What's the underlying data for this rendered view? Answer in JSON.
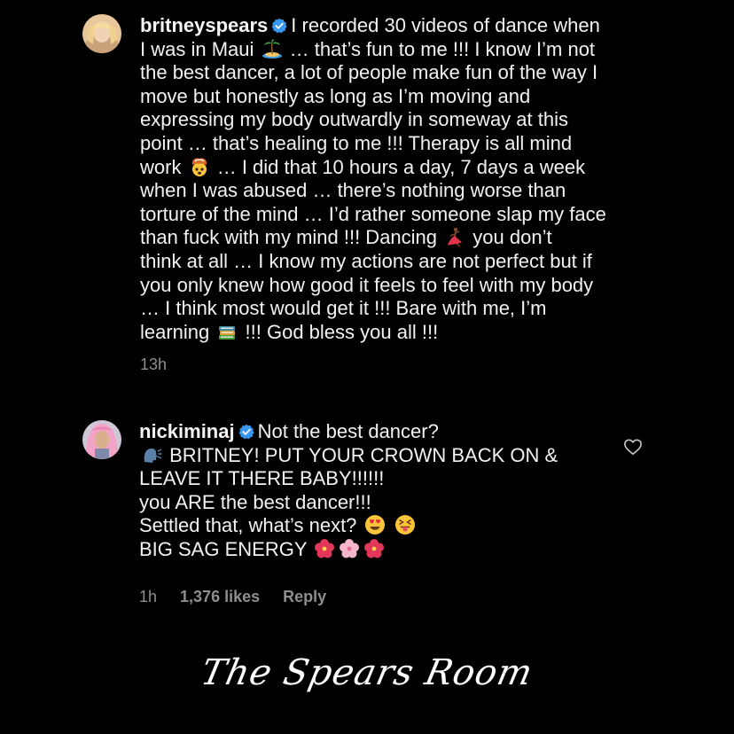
{
  "comments": [
    {
      "username": "britneyspears",
      "lines": [
        "I recorded 30 videos of dance when",
        "I was in Maui",
        "… that’s fun to me !!! I know I’m not",
        "the best dancer, a lot of people make fun of the way I",
        "move but honestly as long as I’m moving and",
        "expressing my body outwardly in someway at this",
        "point … that’s healing to me !!! Therapy is all mind",
        "work",
        "… I did that 10 hours a day, 7 days a week",
        "when I was abused … there’s nothing worse than",
        "torture of the mind … I’d rather someone slap my face",
        "than fuck with my mind !!! Dancing",
        "you don’t",
        "think at all … I know my actions are not perfect but if",
        "you only knew how good it feels to feel with my body",
        "… I think most would get it !!! Bare with me, I’m",
        "learning",
        "!!! God bless you all !!!"
      ],
      "time": "13h"
    },
    {
      "username": "nickiminaj",
      "lines": [
        "Not the best dancer?",
        "BRITNEY! PUT YOUR CROWN BACK ON &",
        "LEAVE IT THERE BABY!!!!!!",
        "you ARE the best dancer!!!",
        "Settled that, what’s next?",
        "BIG SAG ENERGY"
      ],
      "time": "1h",
      "likes": "1,376 likes",
      "reply": "Reply"
    }
  ],
  "emojis": [
    "desert-island",
    "exploding-head",
    "dancer",
    "books",
    "speaking-head",
    "heart-eyes",
    "squinting-tongue",
    "hibiscus",
    "cherry-blossom",
    "hibiscus"
  ],
  "watermark": "The Spears Room",
  "colors": {
    "background": "#000000",
    "text": "#f2f2f2",
    "meta": "#8e8e8e",
    "verified": "#3897f0"
  }
}
